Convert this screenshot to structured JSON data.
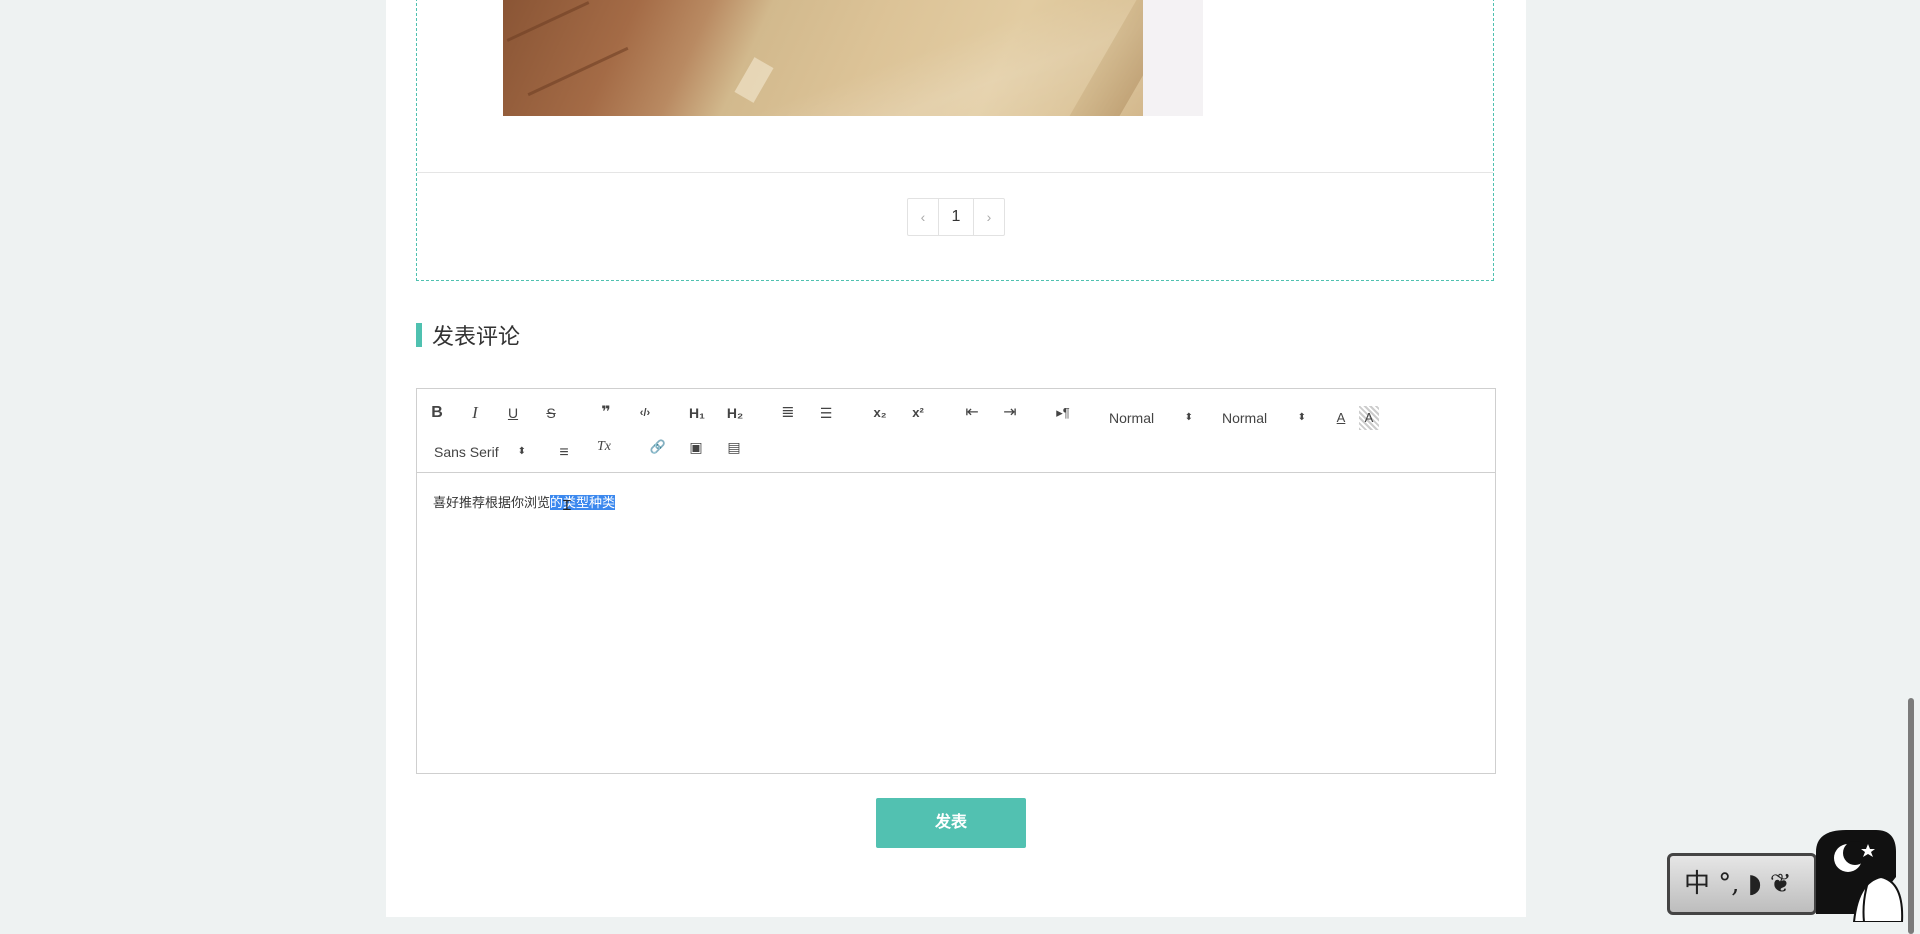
{
  "pagination": {
    "prev": "‹",
    "current": "1",
    "next": "›"
  },
  "comment_section": {
    "title": "发表评论"
  },
  "editor": {
    "toolbar": {
      "bold": "B",
      "italic": "I",
      "underline": "U",
      "strike": "S",
      "blockquote": "❞",
      "code": "‹/›",
      "h1": "H₁",
      "h2": "H₂",
      "ordered_list": "≣",
      "bullet_list": "☰",
      "subscript": "x₂",
      "superscript": "x²",
      "outdent": "⇤",
      "indent": "⇥",
      "direction": "▸¶",
      "size_select": "Normal",
      "header_select": "Normal",
      "color": "A",
      "background": "A",
      "font_select": "Sans Serif",
      "align": "≡",
      "clean": "Tx",
      "link": "🔗",
      "image": "▣",
      "video": "▤"
    },
    "content": {
      "text_plain": "喜好推荐根据你浏览",
      "text_selected": "的类型种类"
    }
  },
  "publish_button": {
    "label": "发表"
  },
  "ime": {
    "label": "中 °, ◗ ❦"
  }
}
